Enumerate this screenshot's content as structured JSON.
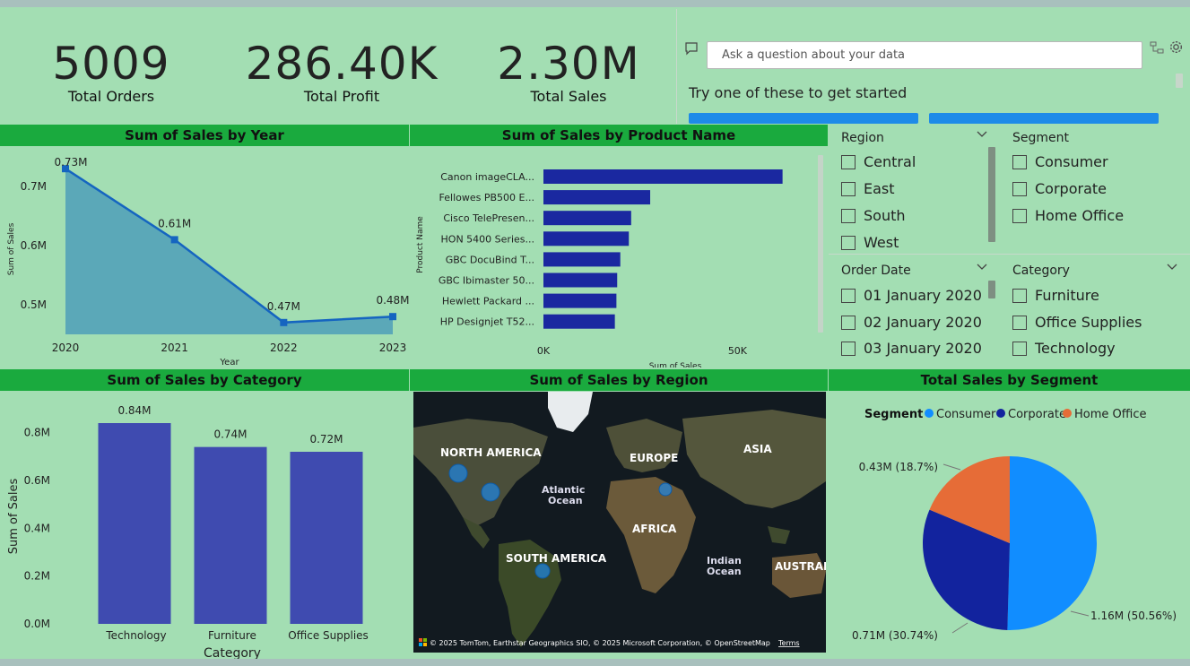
{
  "kpis": [
    {
      "value": "5009",
      "label": "Total Orders"
    },
    {
      "value": "286.40K",
      "label": "Total Profit"
    },
    {
      "value": "2.30M",
      "label": "Total Sales"
    }
  ],
  "qa": {
    "placeholder": "Ask a question about your data",
    "try_text": "Try one of these to get started"
  },
  "slicers": {
    "region": {
      "title": "Region",
      "items": [
        "Central",
        "East",
        "South",
        "West"
      ]
    },
    "segment": {
      "title": "Segment",
      "items": [
        "Consumer",
        "Corporate",
        "Home Office"
      ]
    },
    "order_date": {
      "title": "Order Date",
      "items": [
        "01 January 2020",
        "02 January 2020",
        "03 January 2020"
      ]
    },
    "category": {
      "title": "Category",
      "items": [
        "Furniture",
        "Office Supplies",
        "Technology"
      ]
    }
  },
  "colors": {
    "header_bg": "#1aaa3e",
    "canvas_bg": "#a3deb3",
    "bar_dark": "#1a28a0",
    "bar_cat": "#3f4bb0",
    "area": "#5ba8b8",
    "line": "#1565c0",
    "consumer": "#118dff",
    "corporate": "#12239e",
    "home_office": "#e66c37"
  },
  "map": {
    "title": "Sum of Sales by Region",
    "labels": [
      "NORTH AMERICA",
      "EUROPE",
      "ASIA",
      "Atlantic",
      "Ocean",
      "AFRICA",
      "SOUTH AMERICA",
      "Indian",
      "Ocean",
      "AUSTRALI"
    ],
    "attribution": "© 2025 TomTom, Earthstar Geographics SIO, © 2025 Microsoft Corporation, © OpenStreetMap",
    "terms": "Terms",
    "ms_logo": "Microsoft Bing"
  },
  "chart_data": [
    {
      "type": "area",
      "title": "Sum of Sales by Year",
      "xlabel": "Year",
      "ylabel": "Sum of Sales",
      "x": [
        "2020",
        "2021",
        "2022",
        "2023"
      ],
      "values": [
        0.73,
        0.61,
        0.47,
        0.48
      ],
      "data_labels": [
        "0.73M",
        "0.61M",
        "0.47M",
        "0.48M"
      ],
      "yticks": [
        "0.5M",
        "0.6M",
        "0.7M"
      ],
      "ytick_values": [
        0.5,
        0.6,
        0.7
      ],
      "ylim": [
        0.45,
        0.75
      ]
    },
    {
      "type": "bar",
      "orientation": "horizontal",
      "title": "Sum of Sales by Product Name",
      "xlabel": "Sum of Sales",
      "ylabel": "Product Name",
      "categories": [
        "Canon imageCLA...",
        "Fellowes PB500 E...",
        "Cisco TelePresen...",
        "HON 5400 Series...",
        "GBC DocuBind T...",
        "GBC Ibimaster 50...",
        "Hewlett Packard ...",
        "HP Designjet T52..."
      ],
      "values": [
        61600,
        27500,
        22600,
        22000,
        19800,
        19000,
        18800,
        18400
      ],
      "xticks": [
        "0K",
        "50K"
      ],
      "xtick_values": [
        0,
        50000
      ],
      "xlim": [
        0,
        70000
      ]
    },
    {
      "type": "bar",
      "title": "Sum of Sales by Category",
      "xlabel": "Category",
      "ylabel": "Sum of Sales",
      "categories": [
        "Technology",
        "Furniture",
        "Office Supplies"
      ],
      "values": [
        0.84,
        0.74,
        0.72
      ],
      "data_labels": [
        "0.84M",
        "0.74M",
        "0.72M"
      ],
      "yticks": [
        "0.0M",
        "0.2M",
        "0.4M",
        "0.6M",
        "0.8M"
      ],
      "ytick_values": [
        0,
        0.2,
        0.4,
        0.6,
        0.8
      ],
      "ylim": [
        0,
        0.84
      ]
    },
    {
      "type": "pie",
      "title": "Total Sales by Segment",
      "legend_title": "Segment",
      "categories": [
        "Consumer",
        "Corporate",
        "Home Office"
      ],
      "values": [
        1.16,
        0.71,
        0.43
      ],
      "percent": [
        50.56,
        30.74,
        18.7
      ],
      "data_labels": [
        "1.16M (50.56%)",
        "0.71M (30.74%)",
        "0.43M (18.7%)"
      ]
    }
  ]
}
